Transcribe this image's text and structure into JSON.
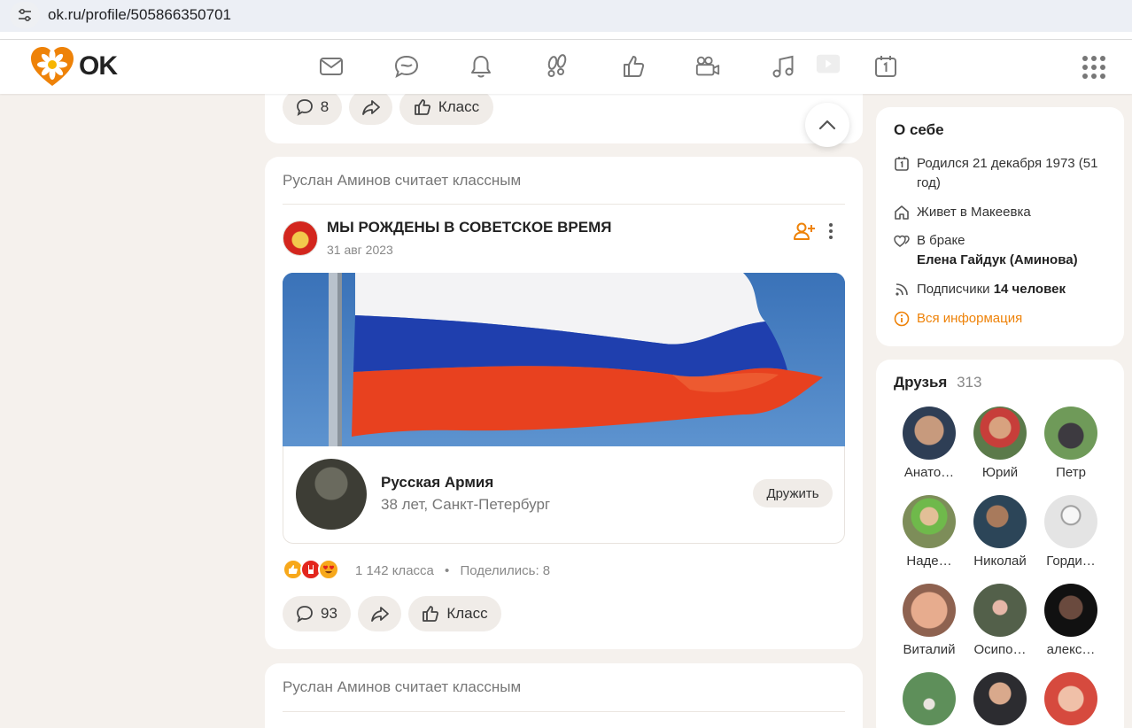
{
  "browser": {
    "url": "ok.ru/profile/505866350701"
  },
  "header": {
    "logo_text": "OK"
  },
  "feed": {
    "top_card": {
      "comments": "8",
      "like_label": "Класс"
    },
    "post": {
      "liked_by": "Руслан Аминов считает классным",
      "group_title": "МЫ РОЖДЕНЫ В СОВЕТСКОЕ ВРЕМЯ",
      "date": "31 авг 2023",
      "profile": {
        "name": "Русская Армия",
        "subtitle": "38 лет, Санкт-Петербург",
        "button": "Дружить"
      },
      "stats": {
        "likes": "1 142 класса",
        "dot": "•",
        "shares": "Поделились: 8"
      },
      "comments": "93",
      "like_label": "Класс"
    },
    "next_post": {
      "liked_by": "Руслан Аминов считает классным"
    }
  },
  "about": {
    "title": "О себе",
    "born": "Родился 21 декабря 1973 (51 год)",
    "lives": "Живет в Макеевка",
    "married_label": "В браке",
    "spouse": "Елена Гайдук (Аминова)",
    "subscribers_label": "Подписчики",
    "subscribers_count": "14 человек",
    "all_info": "Вся информация"
  },
  "friends": {
    "title": "Друзья",
    "count": "313",
    "items": [
      {
        "name": "Анато…"
      },
      {
        "name": "Юрий"
      },
      {
        "name": "Петр"
      },
      {
        "name": "Наде…"
      },
      {
        "name": "Николай"
      },
      {
        "name": "Горди…"
      },
      {
        "name": "Виталий"
      },
      {
        "name": "Осипо…"
      },
      {
        "name": "алекс…"
      },
      {
        "name": ""
      },
      {
        "name": ""
      },
      {
        "name": ""
      }
    ]
  },
  "colors": {
    "accent": "#ee8208",
    "background": "#f5f1ed"
  }
}
